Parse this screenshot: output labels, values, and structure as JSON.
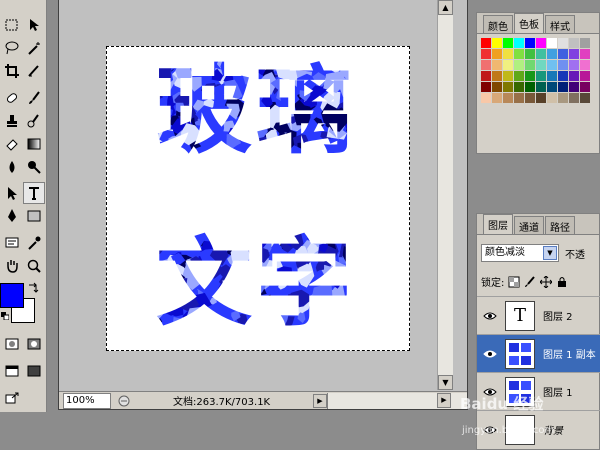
{
  "toolbox": {
    "tools": [
      "marquee",
      "move",
      "lasso",
      "magic-wand",
      "crop",
      "slice",
      "healing-brush",
      "brush",
      "clone-stamp",
      "history-brush",
      "eraser",
      "gradient",
      "blur",
      "dodge",
      "path-select",
      "type",
      "pen",
      "shape",
      "notes",
      "eyedropper",
      "hand",
      "zoom"
    ],
    "foreground_color": "#0000ff",
    "background_color": "#ffffff"
  },
  "document": {
    "zoom": "100%",
    "doc_info": "文档:263.7K/703.1K",
    "canvas_words": [
      "玻璃",
      "文字"
    ],
    "glass_colors": [
      "#0a0ad0",
      "#2a3aff",
      "#5a6cff",
      "#9aa8ff",
      "#d8e0ff",
      "#000060",
      "#1818b0"
    ]
  },
  "swatches": {
    "tabs": [
      "颜色",
      "色板",
      "样式"
    ],
    "active_tab": 1,
    "colors": [
      "#ff0000",
      "#ffff00",
      "#00ff00",
      "#00ffff",
      "#0000ff",
      "#ff00ff",
      "#ffffff",
      "#e0e0e0",
      "#c0c0c0",
      "#a0a0a0",
      "#f03030",
      "#f0a020",
      "#f0e040",
      "#80e040",
      "#40c040",
      "#40c0a0",
      "#40a0e0",
      "#4060e0",
      "#8040e0",
      "#e040c0",
      "#f07070",
      "#f0b870",
      "#f0f080",
      "#b0f080",
      "#70d870",
      "#70d8c0",
      "#70c0f0",
      "#7090f0",
      "#a070f0",
      "#f070d0",
      "#c01818",
      "#c07818",
      "#c0b818",
      "#60a818",
      "#189818",
      "#18987c",
      "#1878b8",
      "#1838b8",
      "#6818b8",
      "#b81898",
      "#800000",
      "#804800",
      "#807800",
      "#386800",
      "#006000",
      "#006050",
      "#004878",
      "#002078",
      "#400078",
      "#780060",
      "#f8c8a8",
      "#d8a878",
      "#b88858",
      "#987048",
      "#785838",
      "#584028",
      "#d0c0a8",
      "#a89880",
      "#807060",
      "#584838"
    ]
  },
  "layers": {
    "tabs": [
      "图层",
      "通道",
      "路径"
    ],
    "active_tab": 0,
    "blend_mode": "颜色减淡",
    "opacity_label": "不透",
    "lock_label": "锁定:",
    "items": [
      {
        "name": "图层 2",
        "thumb": "T",
        "selected": false,
        "italic": false
      },
      {
        "name": "图层 1 副本",
        "thumb": "glass",
        "selected": true,
        "italic": false
      },
      {
        "name": "图层 1",
        "thumb": "glass",
        "selected": false,
        "italic": false
      },
      {
        "name": "背景",
        "thumb": "blank",
        "selected": false,
        "italic": true
      }
    ]
  },
  "watermark": {
    "text": "Baidu 经验",
    "sub": "jingyan.baidu.com"
  }
}
